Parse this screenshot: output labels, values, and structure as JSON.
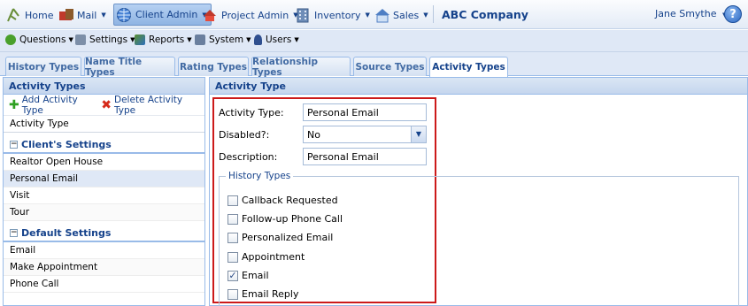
{
  "nav": {
    "items": [
      {
        "label": "Home"
      },
      {
        "label": "Mail"
      },
      {
        "label": "Client Admin"
      },
      {
        "label": "Project Admin"
      },
      {
        "label": "Inventory"
      },
      {
        "label": "Sales"
      }
    ],
    "company": "ABC Company",
    "user": "Jane Smythe",
    "help": "?"
  },
  "toolbar2": {
    "items": [
      {
        "label": "Questions"
      },
      {
        "label": "Settings"
      },
      {
        "label": "Reports"
      },
      {
        "label": "System"
      },
      {
        "label": "Users"
      }
    ]
  },
  "tabs": [
    {
      "label": "History Types"
    },
    {
      "label": "Name Title Types"
    },
    {
      "label": "Rating Types"
    },
    {
      "label": "Relationship Types"
    },
    {
      "label": "Source Types"
    },
    {
      "label": "Activity Types",
      "active": true
    }
  ],
  "left": {
    "title": "Activity Types",
    "add_label": "Add Activity Type",
    "delete_label": "Delete Activity Type",
    "header_row": "Activity Type",
    "group1": "Client's Settings",
    "group1_rows": [
      "Realtor Open House",
      "Personal Email",
      "Visit",
      "Tour"
    ],
    "group2": "Default Settings",
    "group2_rows": [
      "Email",
      "Make Appointment",
      "Phone Call"
    ]
  },
  "right": {
    "title": "Activity Type",
    "activity_type_label": "Activity Type:",
    "activity_type_value": "Personal Email",
    "disabled_label": "Disabled?:",
    "disabled_value": "No",
    "description_label": "Description:",
    "description_value": "Personal Email",
    "history_legend": "History Types",
    "history_types": [
      {
        "label": "Callback Requested",
        "checked": false
      },
      {
        "label": "Follow-up Phone Call",
        "checked": false
      },
      {
        "label": "Personalized Email",
        "checked": false
      },
      {
        "label": "Appointment",
        "checked": false
      },
      {
        "label": "Email",
        "checked": true
      },
      {
        "label": "Email Reply",
        "checked": false
      }
    ]
  },
  "colors": {
    "accent": "#15428b",
    "highlight_border": "#cc1a1a"
  }
}
